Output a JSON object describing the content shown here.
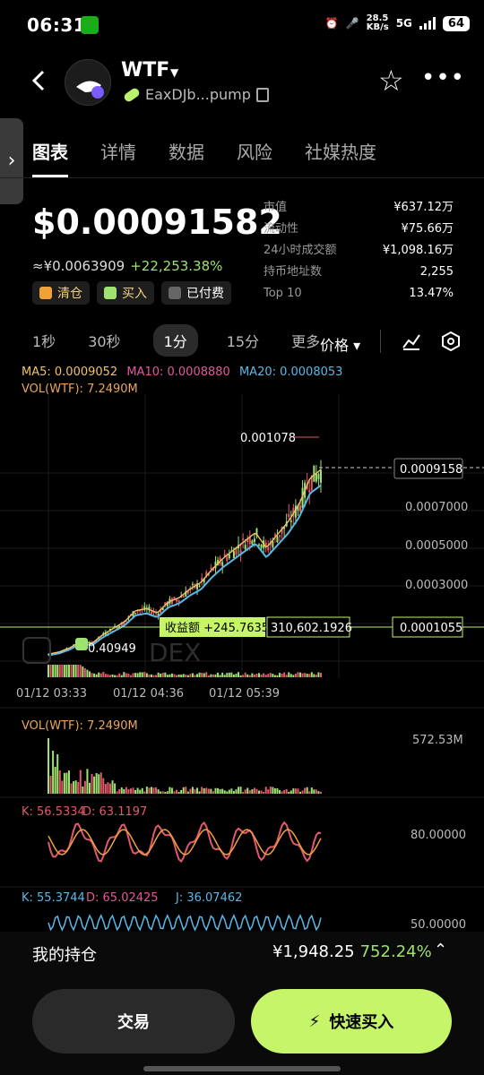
{
  "status": {
    "time": "06:31",
    "net_speed": "28.5\nKB/s",
    "net": "5G",
    "battery": "64"
  },
  "header": {
    "token": "WTF",
    "contract": "EaxDJb...pump"
  },
  "tabs": [
    "图表",
    "详情",
    "数据",
    "风险",
    "社媒热度"
  ],
  "price": {
    "main": "$0.00091582",
    "cny": "≈¥0.0063909",
    "change": "+22,253.38%"
  },
  "chips": [
    {
      "label": "清仓",
      "color": "#f0a23a"
    },
    {
      "label": "买入",
      "color": "#9ee26f"
    },
    {
      "label": "已付费",
      "color": "#888"
    }
  ],
  "stats": [
    {
      "k": "市值",
      "v": "¥637.12万"
    },
    {
      "k": "流动性",
      "v": "¥75.66万"
    },
    {
      "k": "24小时成交额",
      "v": "¥1,098.16万"
    },
    {
      "k": "持币地址数",
      "v": "2,255"
    },
    {
      "k": "Top 10",
      "v": "13.47%"
    }
  ],
  "timeframes": [
    "1秒",
    "30秒",
    "1分",
    "15分",
    "更多"
  ],
  "selected_tf": "1分",
  "price_toggle": "价格",
  "indicators": {
    "ma5": "MA5: 0.0009052",
    "ma10": "MA10: 0.0008880",
    "ma20": "MA20: 0.0008053",
    "vol": "VOL(WTF): 7.2490M",
    "vol2": "VOL(WTF): 7.2490M",
    "vol2_max": "572.53M",
    "kd": "K: 56.5334",
    "d": "D: 63.1197",
    "kd_level": "80.00000",
    "k2": "K: 55.3744",
    "d2": "D: 65.02425",
    "j2": "J: 36.07462",
    "kdj_level": "50.00000"
  },
  "chart_data": {
    "type": "candlestick",
    "x": [
      "01/12 03:33",
      "01/12 04:36",
      "01/12 05:39"
    ],
    "y_ticks": [
      "0.0007000",
      "0.0005000",
      "0.0003000"
    ],
    "current": "0.0009158",
    "high": "0.001078",
    "low": "0.40949",
    "cost": "0.0001055",
    "profit_label": "收益额 +245.7635",
    "profit_value": "310,602.1926",
    "watermark": "DEX",
    "colors": {
      "up": "#9ee26f",
      "down": "#e05a6b",
      "ma5": "#f0c26a",
      "ma10": "#e05a9a",
      "ma20": "#5ab8e8"
    },
    "series_trend": [
      7e-05,
      8e-05,
      0.0001,
      0.00013,
      0.00012,
      0.00016,
      0.00019,
      0.00022,
      0.00027,
      0.00028,
      0.00026,
      0.00031,
      0.00033,
      0.00037,
      0.0004,
      0.00046,
      0.00051,
      0.00055,
      0.00059,
      0.00063,
      0.00056,
      0.00062,
      0.00068,
      0.00076,
      0.00088,
      0.00092
    ]
  },
  "bottom": {
    "hold_label": "我的持仓",
    "hold_value": "¥1,948.25",
    "hold_pct": "752.24%",
    "trade": "交易",
    "quick_buy": "快速买入"
  }
}
